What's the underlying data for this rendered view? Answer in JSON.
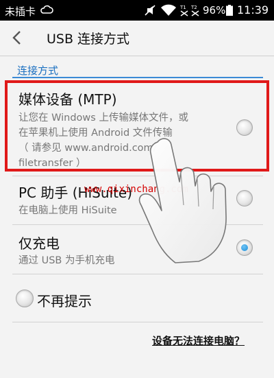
{
  "status_bar": {
    "carrier": "未插卡",
    "sim1_label": "T1",
    "sim2_label": "T2",
    "battery": "96%",
    "time": "11:39",
    "icons": [
      "cloud-icon",
      "mute-icon",
      "wifi-icon",
      "signal-icon",
      "battery-icon"
    ]
  },
  "header": {
    "title": "USB 连接方式"
  },
  "section": {
    "title": "连接方式"
  },
  "options": [
    {
      "title": "媒体设备 (MTP)",
      "desc_line1": "让您在 Windows 上传输媒体文件，或",
      "desc_line2": "在苹果机上使用 Android 文件传输",
      "desc_line3": "（ 请参见 www.android.com/",
      "desc_line4": "filetransfer ）",
      "selected": false
    },
    {
      "title": "PC 助手 (HiSuite)",
      "desc_line1": "在电脑上使用 HiSuite",
      "selected": false
    },
    {
      "title": "仅充电",
      "desc_line1": "通过 USB 为手机充电",
      "selected": true
    }
  ],
  "dont_remind": {
    "label": "不再提示",
    "checked": false
  },
  "help_link": "设备无法连接电脑？",
  "watermark": "www.qixinchang.com",
  "colors": {
    "accent": "#1a6fc0",
    "highlight": "#e01919",
    "radio_selected": "#1d8ed8"
  }
}
